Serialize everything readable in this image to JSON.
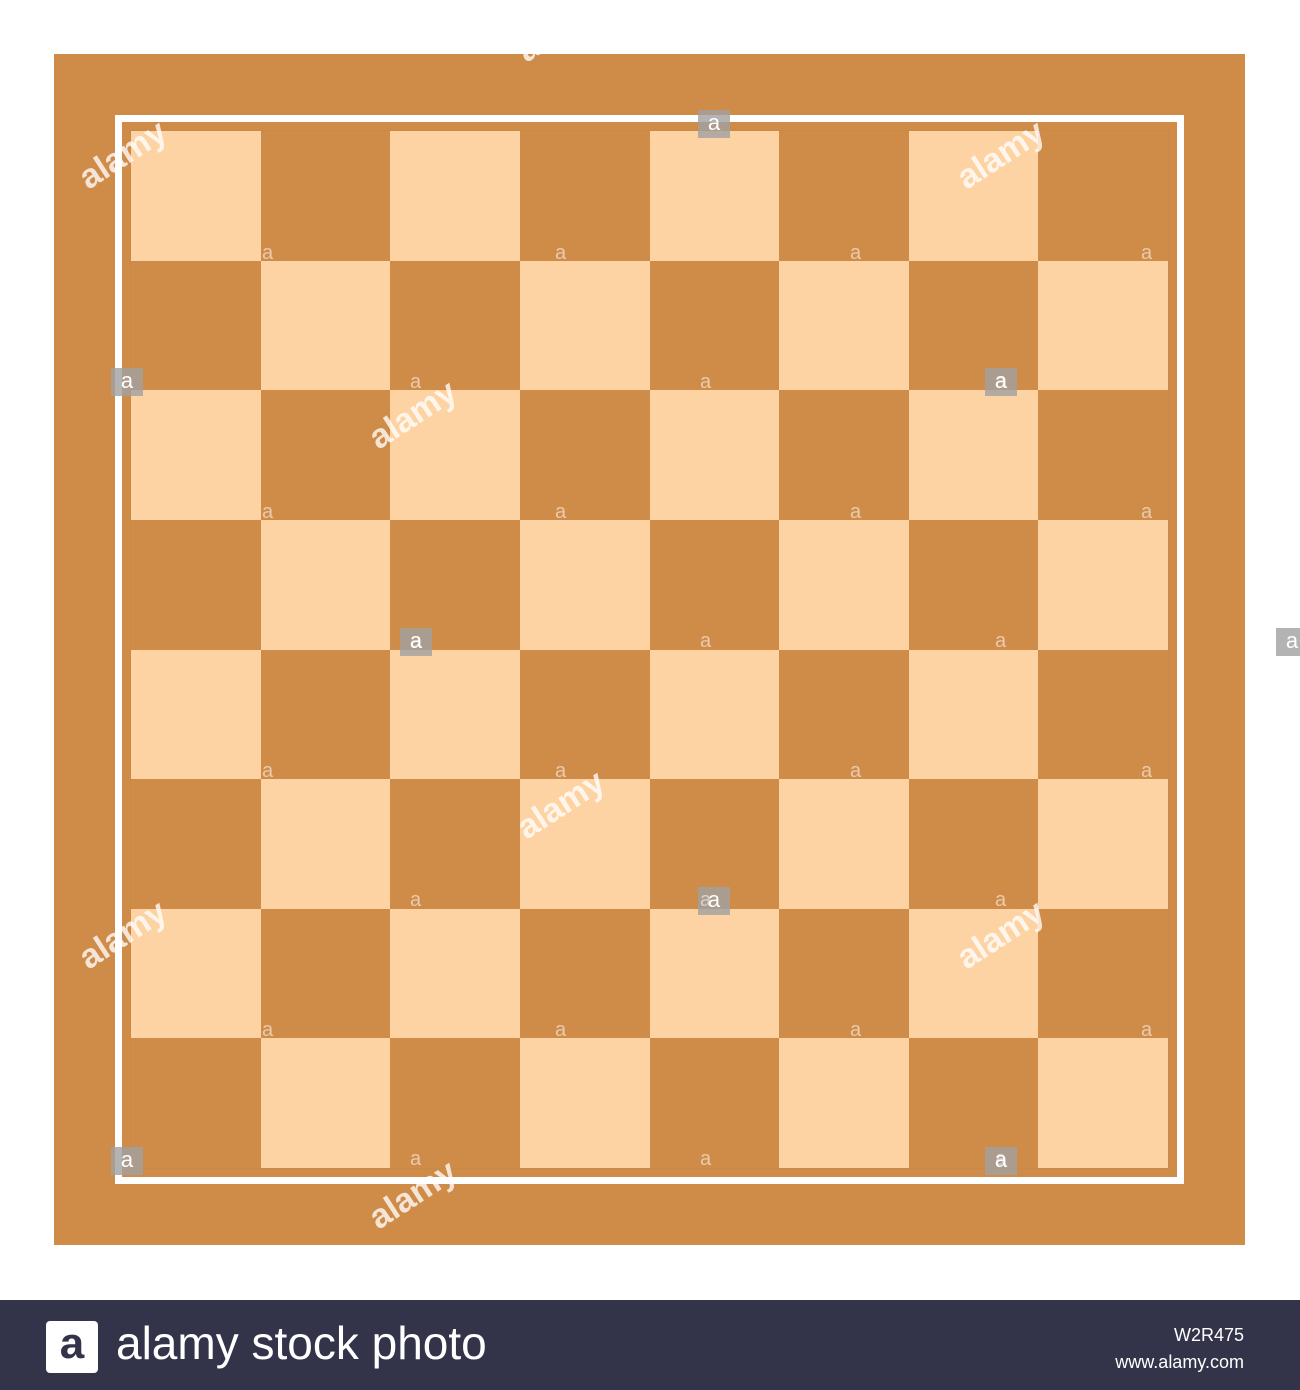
{
  "board": {
    "size": 8,
    "top_left_color": "light",
    "colors": {
      "frame": "#cf8b48",
      "light_square": "#fdd3a3",
      "dark_square": "#cf8b48",
      "inner_line": "#ffffff"
    }
  },
  "watermark": {
    "word": "alamy",
    "badge_letter": "a"
  },
  "footer": {
    "logo_letter": "a",
    "brand_text": "alamy stock photo",
    "image_id": "W2R475",
    "url": "www.alamy.com",
    "background": "#33334a"
  }
}
